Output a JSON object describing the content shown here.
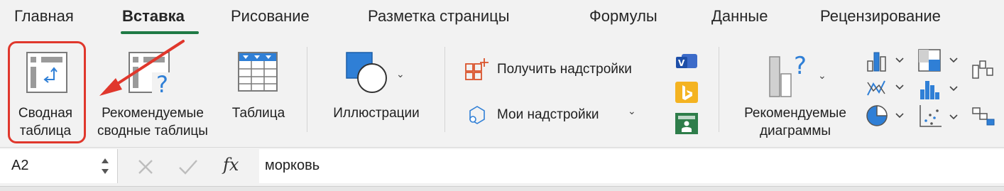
{
  "tabs": [
    {
      "label": "Главная"
    },
    {
      "label": "Вставка"
    },
    {
      "label": "Рисование"
    },
    {
      "label": "Разметка страницы"
    },
    {
      "label": "Формулы"
    },
    {
      "label": "Данные"
    },
    {
      "label": "Рецензирование"
    }
  ],
  "active_tab_index": 1,
  "ribbon": {
    "pivot_table": {
      "line1": "Сводная",
      "line2": "таблица"
    },
    "recommended_pivot": {
      "line1": "Рекомендуемые",
      "line2": "сводные таблицы"
    },
    "table": {
      "label": "Таблица"
    },
    "illustrations": {
      "label": "Иллюстрации"
    },
    "get_addins": {
      "label": "Получить надстройки"
    },
    "my_addins": {
      "label": "Мои надстройки"
    },
    "recommended_charts": {
      "line1": "Рекомендуемые",
      "line2": "диаграммы"
    }
  },
  "formula_bar": {
    "name_box": "A2",
    "fx_label": "fx",
    "content": "морковь"
  },
  "colors": {
    "accent_green": "#1f7a45",
    "highlight_red": "#e0372c",
    "icon_blue": "#2f7fd6"
  }
}
